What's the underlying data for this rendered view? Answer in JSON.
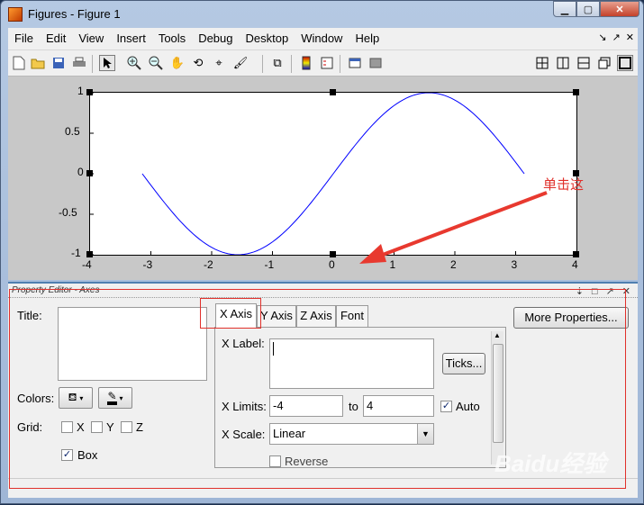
{
  "window": {
    "title": "Figures - Figure 1",
    "min": "▁",
    "max": "▢",
    "close": "✕"
  },
  "menu": [
    "File",
    "Edit",
    "View",
    "Insert",
    "Tools",
    "Debug",
    "Desktop",
    "Window",
    "Help"
  ],
  "menu_right": [
    "↘",
    "↗",
    "✕"
  ],
  "toolbar_icons": [
    "new-figure-icon",
    "open-folder-icon",
    "save-icon",
    "print-icon",
    "pointer-icon",
    "zoom-in-icon",
    "zoom-out-icon",
    "pan-hand-icon",
    "rotate-3d-icon",
    "data-cursor-icon",
    "brush-icon",
    "link-icon",
    "colorbar-icon",
    "legend-icon",
    "hide-plot-tools-icon",
    "show-plot-tools-icon",
    "tile-icon",
    "split-vertical-icon",
    "split-horizontal-icon",
    "float-icon",
    "maximize-icon"
  ],
  "chart_data": {
    "type": "line",
    "x_ticks": [
      "-4",
      "-3",
      "-2",
      "-1",
      "0",
      "1",
      "2",
      "3",
      "4"
    ],
    "y_ticks": [
      "1",
      "0.5",
      "0",
      "-0.5",
      "-1"
    ],
    "xlim": [
      -4,
      4
    ],
    "ylim": [
      -1,
      1
    ],
    "series": [
      {
        "function": "sin(x)",
        "x_range": [
          -3.1416,
          3.1416
        ],
        "color": "#0000ff"
      }
    ]
  },
  "annotation": {
    "text": "单击这"
  },
  "property_editor": {
    "header": "Property Editor - Axes",
    "title_label": "Title:",
    "colors_label": "Colors:",
    "grid_label": "Grid:",
    "grid_x": "X",
    "grid_y": "Y",
    "grid_z": "Z",
    "box_label": "Box",
    "box_checked": "✓",
    "tabs": [
      "X Axis",
      "Y Axis",
      "Z Axis",
      "Font"
    ],
    "xlabel_label": "X Label:",
    "ticks_button": "Ticks...",
    "xlimits_label": "X Limits:",
    "xlim_min": "-4",
    "to_label": "to",
    "xlim_max": "4",
    "auto_label": "Auto",
    "auto_checked": "✓",
    "xscale_label": "X Scale:",
    "xscale_value": "Linear",
    "reverse_label": "Reverse",
    "more_properties": "More Properties..."
  },
  "watermark": "Baidu经验"
}
